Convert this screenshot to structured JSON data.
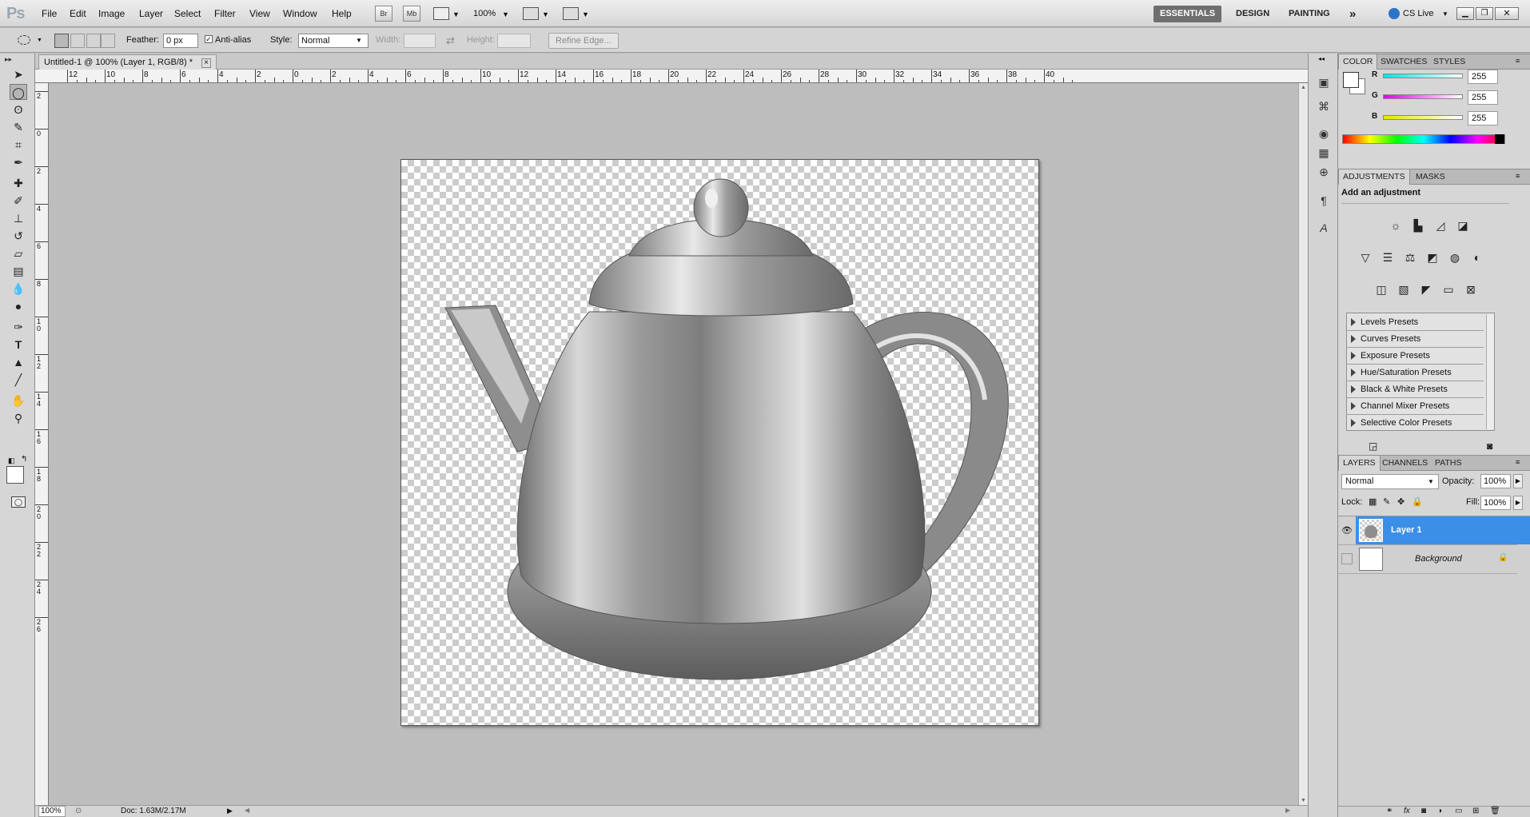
{
  "app": {
    "logo": "Ps",
    "menus": [
      "File",
      "Edit",
      "Image",
      "Layer",
      "Select",
      "Filter",
      "View",
      "Window",
      "Help"
    ],
    "zoom": "100%",
    "bridge_label": "Br",
    "mini_bridge_label": "Mb",
    "workspaces": [
      "ESSENTIALS",
      "DESIGN",
      "PAINTING"
    ],
    "more_workspaces": "»",
    "cs_live": "CS Live"
  },
  "options": {
    "feather_label": "Feather:",
    "feather_value": "0 px",
    "antialias_label": "Anti-alias",
    "antialias_checked": true,
    "style_label": "Style:",
    "style_value": "Normal",
    "width_label": "Width:",
    "height_label": "Height:",
    "refine_edge": "Refine Edge..."
  },
  "document": {
    "tab_title": "Untitled-1 @ 100% (Layer 1, RGB/8) *",
    "close": "×",
    "hruler_labels": [
      "12",
      "10",
      "8",
      "6",
      "4",
      "2",
      "0",
      "2",
      "4",
      "6",
      "8",
      "10",
      "12",
      "14",
      "16",
      "18",
      "20",
      "22",
      "24",
      "26",
      "28",
      "30",
      "32",
      "34",
      "36",
      "38",
      "40"
    ],
    "vruler_labels": [
      "2",
      "0",
      "2",
      "4",
      "6",
      "8",
      "1 0",
      "1 2",
      "1 4",
      "1 6",
      "1 8",
      "2 0",
      "2 2",
      "2 4",
      "2 6"
    ]
  },
  "status": {
    "zoom": "100%",
    "doc_info": "Doc: 1.63M/2.17M"
  },
  "color_panel": {
    "tabs": [
      "COLOR",
      "SWATCHES",
      "STYLES"
    ],
    "channels": [
      {
        "name": "R",
        "value": "255",
        "color": "#00e5e5"
      },
      {
        "name": "G",
        "value": "255",
        "color": "#e500e5"
      },
      {
        "name": "B",
        "value": "255",
        "color": "#e5e500"
      }
    ],
    "foreground": "#ffffff",
    "background": "#ffffff"
  },
  "adjustments_panel": {
    "tabs": [
      "ADJUSTMENTS",
      "MASKS"
    ],
    "heading": "Add an adjustment",
    "icons_row1": [
      "brightness-icon",
      "levels-icon",
      "curves-icon",
      "exposure-icon"
    ],
    "icons_row2": [
      "vibrance-icon",
      "hue-saturation-icon",
      "color-balance-icon",
      "black-white-icon",
      "photo-filter-icon",
      "channel-mixer-icon"
    ],
    "icons_row3": [
      "invert-icon",
      "posterize-icon",
      "threshold-icon",
      "gradient-map-icon",
      "selective-color-icon"
    ],
    "presets": [
      "Levels Presets",
      "Curves Presets",
      "Exposure Presets",
      "Hue/Saturation Presets",
      "Black & White Presets",
      "Channel Mixer Presets",
      "Selective Color Presets"
    ]
  },
  "layers_panel": {
    "tabs": [
      "LAYERS",
      "CHANNELS",
      "PATHS"
    ],
    "blend_mode": "Normal",
    "opacity_label": "Opacity:",
    "opacity_value": "100%",
    "lock_label": "Lock:",
    "fill_label": "Fill:",
    "fill_value": "100%",
    "layers": [
      {
        "name": "Layer 1",
        "visible": true,
        "selected": true
      },
      {
        "name": "Background",
        "visible": false,
        "selected": false,
        "locked": true
      }
    ],
    "selection_color": "#3b8fe6"
  }
}
